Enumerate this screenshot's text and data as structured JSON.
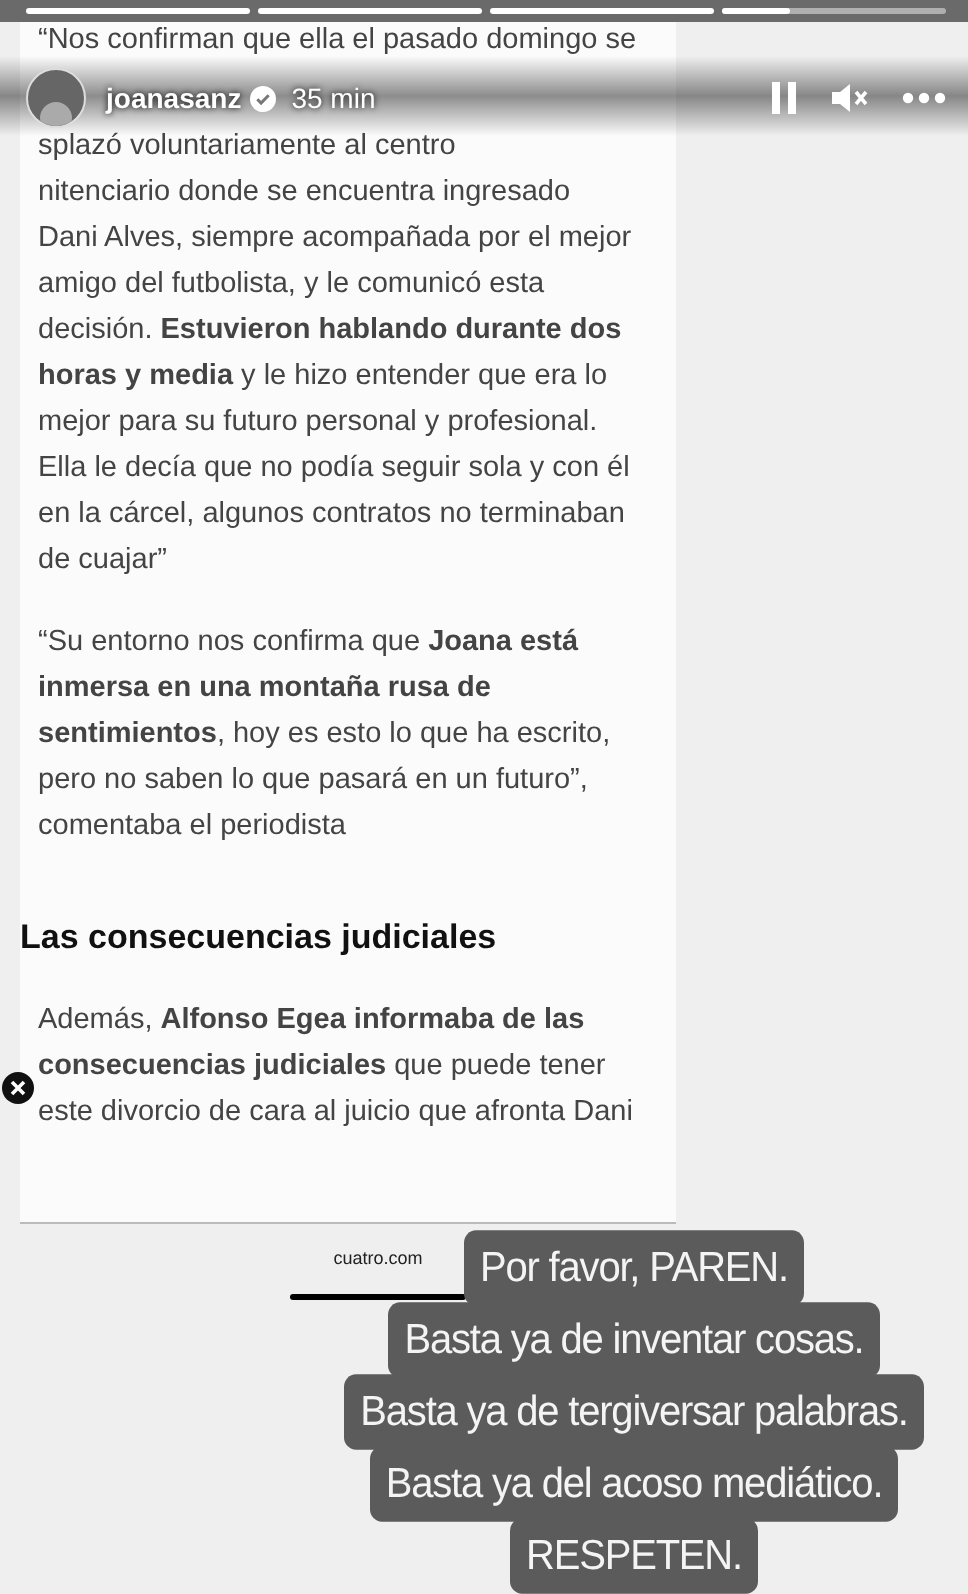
{
  "progress": [
    {
      "kind": "seen"
    },
    {
      "kind": "seen"
    },
    {
      "kind": "seen"
    },
    {
      "kind": "playing"
    }
  ],
  "header": {
    "username": "joanasanz",
    "verified": true,
    "time": "35 min"
  },
  "article": {
    "paragraphs": [
      {
        "lines": [
          "“Nos confirman que ella el pasado domingo se",
          "splazó voluntariamente al centro",
          "nitenciario donde se encuentra ingresado",
          "Dani Alves, siempre acompañada por el mejor",
          "amigo del futbolista, y le comunicó esta",
          "decisión. **Estuvieron hablando durante dos**",
          "**horas y media** y le hizo entender que era lo",
          "mejor para su futuro personal y profesional.",
          "Ella le decía que no podía seguir sola y con él",
          "en la cárcel, algunos contratos no terminaban",
          "de cuajar”"
        ]
      },
      {
        "lines": [
          "“Su entorno nos confirma que **Joana está**",
          "**inmersa en una montaña rusa de**",
          "**sentimientos**, hoy es esto lo que ha escrito,",
          "pero no saben lo que pasará en un futuro”,",
          "comentaba el periodista"
        ]
      },
      {
        "heading": "Las consecuencias judiciales"
      },
      {
        "lines": [
          "Además, **Alfonso Egea informaba de las**",
          "**consecuencias judiciales** que puede tener",
          "este divorcio de cara al juicio que afronta Dani"
        ]
      }
    ]
  },
  "link": {
    "domain": "cuatro.com"
  },
  "stickers": [
    "Por favor, PAREN.",
    "Basta ya de inventar cosas.",
    "Basta ya de tergiversar palabras.",
    "Basta ya del acoso mediático.",
    "RESPETEN."
  ]
}
